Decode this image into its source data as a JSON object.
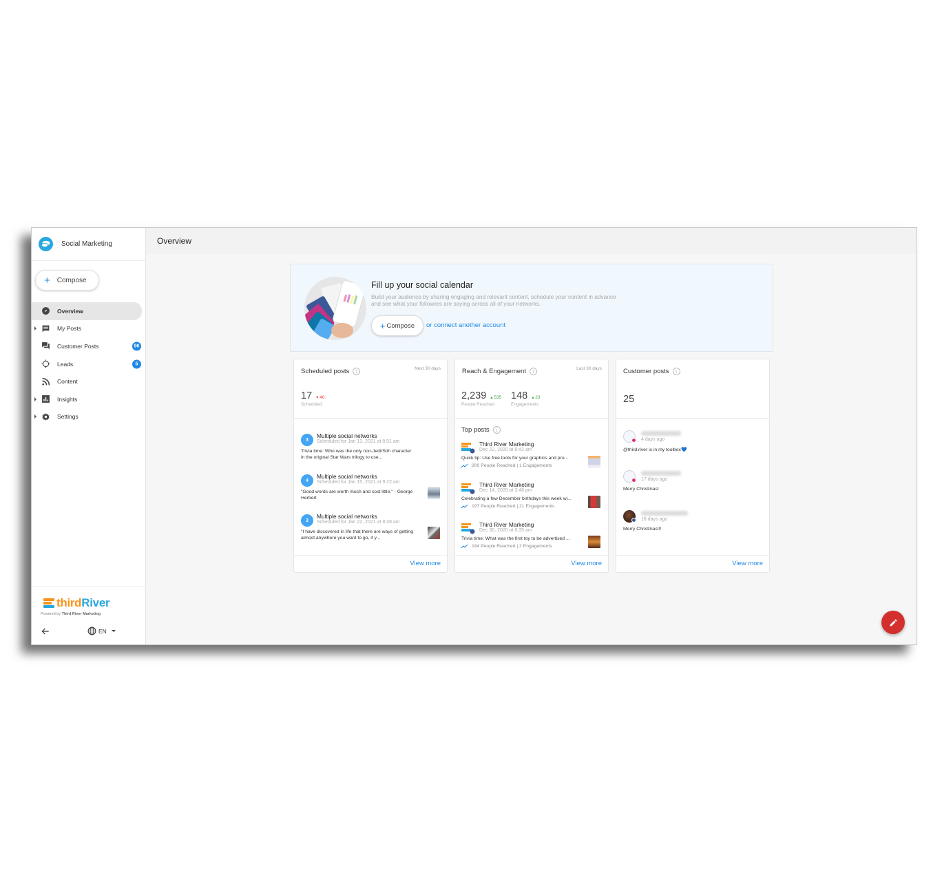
{
  "app": {
    "name": "Social Marketing",
    "page_title": "Overview"
  },
  "sidebar": {
    "compose_label": "Compose",
    "items": [
      {
        "label": "Overview",
        "icon": "compass-icon",
        "active": true,
        "expandable": false
      },
      {
        "label": "My Posts",
        "icon": "comment-icon",
        "active": false,
        "expandable": true
      },
      {
        "label": "Customer Posts",
        "icon": "forum-icon",
        "active": false,
        "expandable": false,
        "badge": "96"
      },
      {
        "label": "Leads",
        "icon": "crosshair-icon",
        "active": false,
        "expandable": false,
        "badge": "5"
      },
      {
        "label": "Content",
        "icon": "rss-icon",
        "active": false,
        "expandable": false
      },
      {
        "label": "Insights",
        "icon": "bar-chart-icon",
        "active": false,
        "expandable": true
      },
      {
        "label": "Settings",
        "icon": "gear-icon",
        "active": false,
        "expandable": true
      }
    ],
    "footer": {
      "logo_part1": "third",
      "logo_part2": "River",
      "powered_prefix": "Powered by",
      "powered_by": "Third River Marketing",
      "language": "EN"
    }
  },
  "banner": {
    "title": "Fill up your social calendar",
    "description": "Build your audience by sharing engaging and relevant content, schedule your content in advance and see what your followers are saying across all of your networks.",
    "compose_label": "Compose",
    "connect_link": "or connect another account"
  },
  "scheduled": {
    "title": "Scheduled posts",
    "range": "Next 30 days",
    "count": "17",
    "delta": "40",
    "delta_direction": "down",
    "count_label": "Scheduled",
    "items": [
      {
        "networks": "3",
        "title": "Multiple social networks",
        "when": "Scheduled for Jan 13, 2021 at 8:51 am",
        "text": "Trivia time: Who was the only non-Jedi/Sith character in the original Star Wars trilogy to use...",
        "has_thumb": false
      },
      {
        "networks": "4",
        "title": "Multiple social networks",
        "when": "Scheduled for Jan 15, 2021 at 9:22 am",
        "text": "\"Good words are worth much and cost little.\" - George Herbert",
        "has_thumb": true
      },
      {
        "networks": "3",
        "title": "Multiple social networks",
        "when": "Scheduled for Jan 22, 2021 at 8:38 am",
        "text": "\"I have discovered in life that there are ways of getting almost anywhere you want to go, if y...",
        "has_thumb": true
      }
    ],
    "view_more": "View more"
  },
  "reach": {
    "title": "Reach & Engagement",
    "range": "Last 30 days",
    "people_reached": "2,239",
    "people_reached_delta": "535",
    "people_reached_label": "People Reached",
    "engagements": "148",
    "engagements_delta": "23",
    "engagements_label": "Engagements",
    "top_posts_label": "Top posts",
    "top_posts": [
      {
        "author": "Third River Marketing",
        "date": "Dec 22, 2020 at 8:42 am",
        "text": "Quick tip: Use free tools for your graphics and pro...",
        "stats": "200 People Reached | 1 Engagements"
      },
      {
        "author": "Third River Marketing",
        "date": "Dec 14, 2020 at 3:48 pm",
        "text": "Celebrating a few December birthdays this week wi...",
        "stats": "197 People Reached | 21 Engagements"
      },
      {
        "author": "Third River Marketing",
        "date": "Dec 30, 2020 at 8:35 am",
        "text": "Trivia time: What was the first toy to be advertised ...",
        "stats": "184 People Reached | 2 Engagements"
      }
    ],
    "view_more": "View more"
  },
  "customer": {
    "title": "Customer posts",
    "count": "25",
    "items": [
      {
        "network": "instagram",
        "time": "4 days ago",
        "text": "@third.river is in my toolbox💙"
      },
      {
        "network": "instagram",
        "time": "17 days ago",
        "text": "Merry Christmas!"
      },
      {
        "network": "facebook",
        "time": "18 days ago",
        "text": "Merry Christmas!!!"
      }
    ],
    "view_more": "View more"
  },
  "colors": {
    "accent": "#1e88e5",
    "fab": "#d32f2f",
    "negative": "#e53935",
    "positive": "#43a047",
    "brand_orange": "#f7941d",
    "brand_blue": "#29a8e0"
  }
}
